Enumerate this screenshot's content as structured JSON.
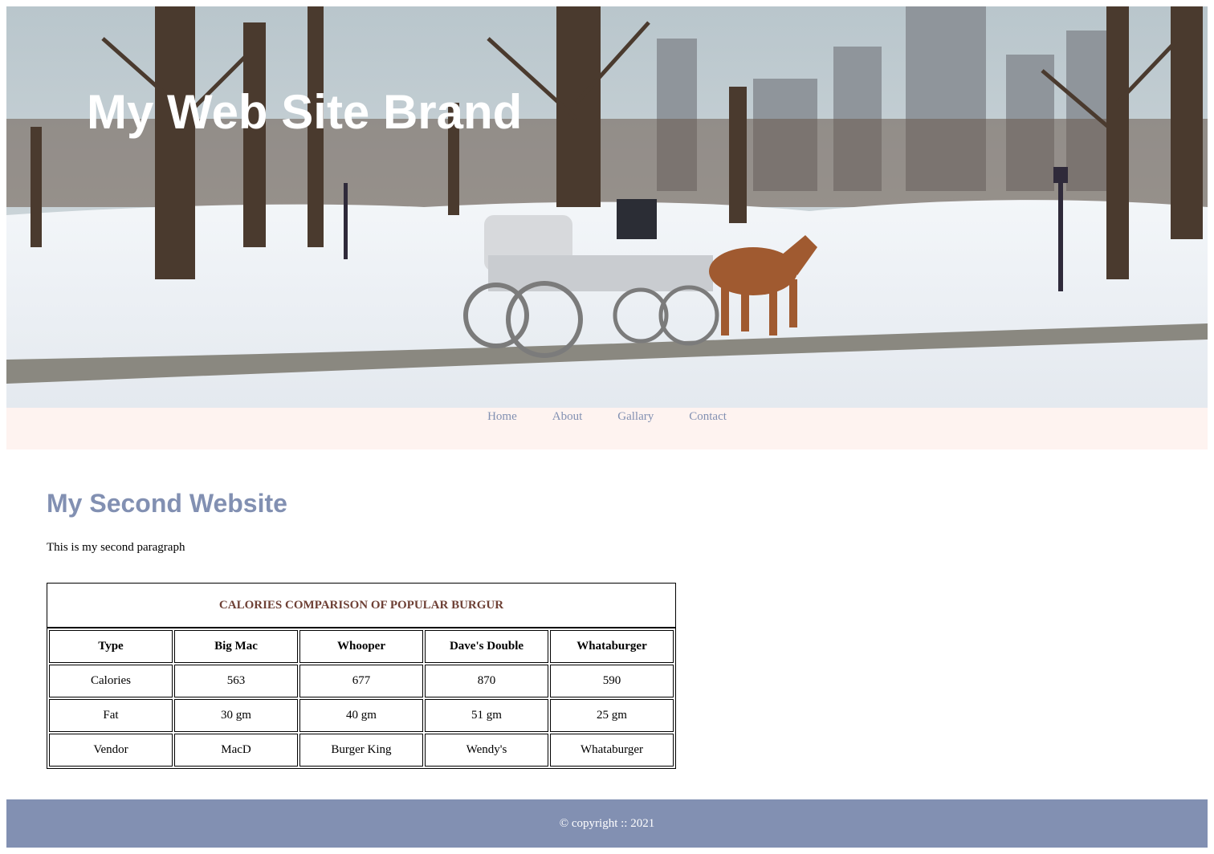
{
  "brand": "My Web Site Brand",
  "nav": {
    "items": [
      {
        "label": "Home"
      },
      {
        "label": "About"
      },
      {
        "label": "Gallary"
      },
      {
        "label": "Contact"
      }
    ]
  },
  "main": {
    "heading": "My Second Website",
    "paragraph": "This is my second paragraph"
  },
  "table": {
    "caption": "CALORIES COMPARISON OF POPULAR BURGUR",
    "headers": [
      "Type",
      "Big Mac",
      "Whooper",
      "Dave's Double",
      "Whataburger"
    ],
    "rows": [
      [
        "Calories",
        "563",
        "677",
        "870",
        "590"
      ],
      [
        "Fat",
        "30 gm",
        "40 gm",
        "51 gm",
        "25 gm"
      ],
      [
        "Vendor",
        "MacD",
        "Burger King",
        "Wendy's",
        "Whataburger"
      ]
    ]
  },
  "footer": {
    "text": "© copyright :: 2021"
  },
  "colors": {
    "accent": "#8290b2",
    "nav_bg": "#fef3f0",
    "caption": "#6e4035"
  }
}
